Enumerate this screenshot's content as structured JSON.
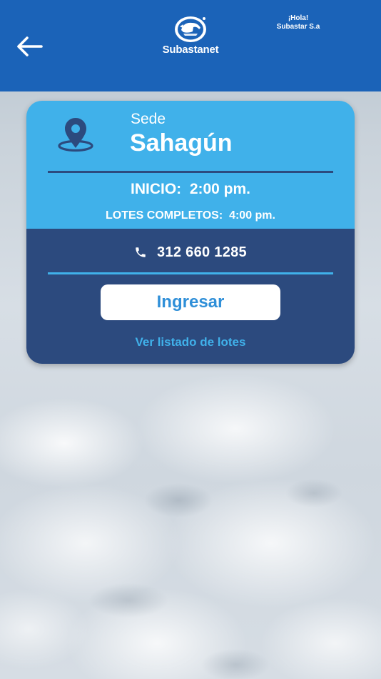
{
  "header": {
    "brand": "Subastanet",
    "greeting_line1": "¡Hola!",
    "greeting_line2": "Subastar S.a",
    "back_icon": "arrow-left-icon",
    "color": "#1b63b8"
  },
  "card": {
    "sede_label": "Sede",
    "sede_name": "Sahagún",
    "inicio": "INICIO:  2:00 pm.",
    "lotes_completos": "LOTES COMPLETOS:  4:00 pm.",
    "phone": "312 660 1285",
    "ingresar_label": "Ingresar",
    "ver_listado_label": "Ver listado de lotes",
    "top_color": "#40b1ea",
    "bottom_color": "#2c4a7e",
    "icons": [
      "location-pin-icon",
      "phone-icon"
    ]
  }
}
